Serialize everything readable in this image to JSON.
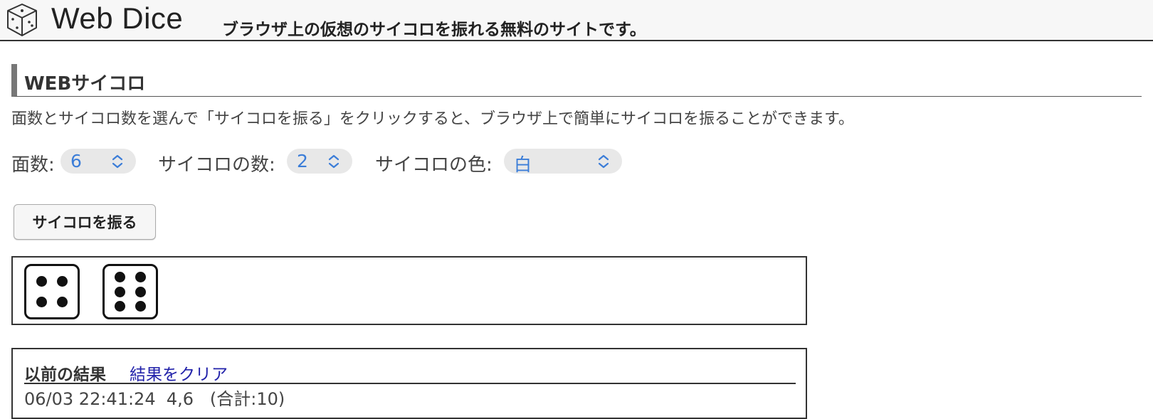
{
  "header": {
    "logo_icon": "dice-outline-icon",
    "site_title": "Web Dice",
    "tagline": "ブラウザ上の仮想のサイコロを振れる無料のサイトです。"
  },
  "main": {
    "section_title": "WEBサイコロ",
    "description": "面数とサイコロ数を選んで「サイコロを振る」をクリックすると、ブラウザ上で簡単にサイコロを振ることができます。",
    "controls": {
      "faces_label": "面数:",
      "faces_value": "6",
      "count_label": "サイコロの数:",
      "count_value": "2",
      "color_label": "サイコロの色:",
      "color_value": "白",
      "accent_color": "#3b7dd8"
    },
    "roll_button_label": "サイコロを振る",
    "dice_results": [
      4,
      6
    ],
    "history": {
      "title": "以前の結果",
      "clear_label": "結果をクリア",
      "entries": [
        "06/03 22:41:24  4,6   (合計:10)"
      ]
    }
  }
}
